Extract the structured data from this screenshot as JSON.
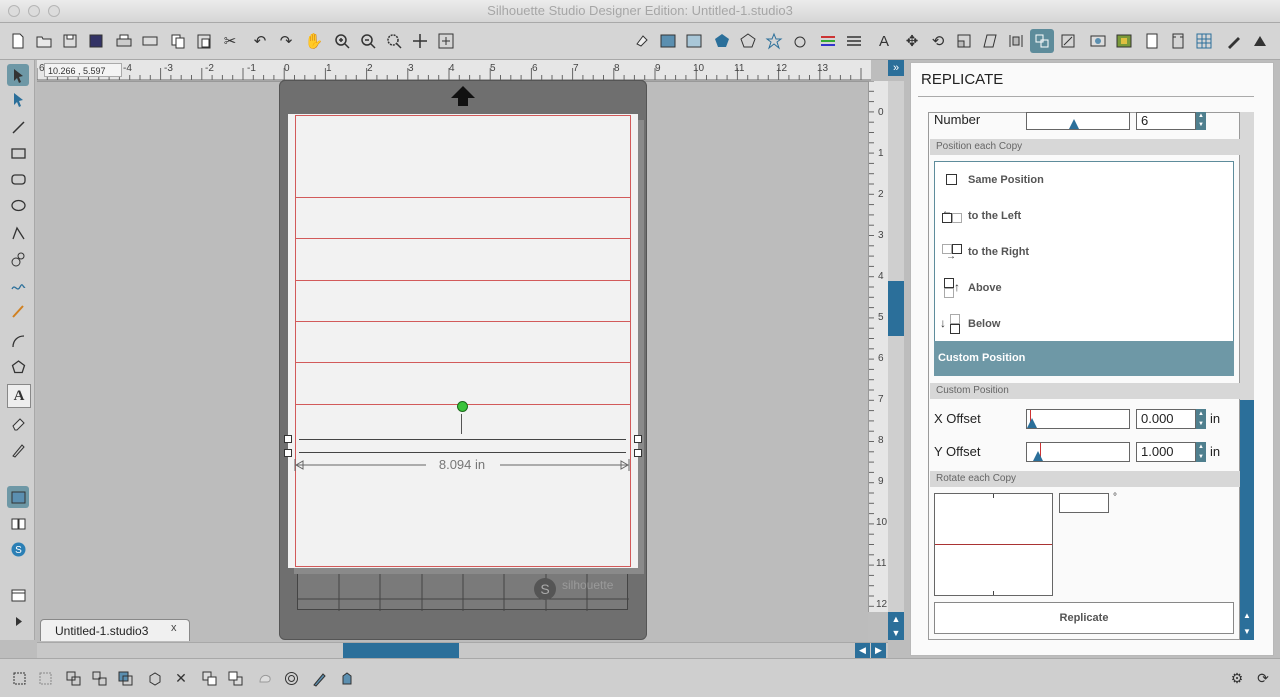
{
  "window": {
    "title": "Silhouette Studio Designer Edition: Untitled-1.studio3"
  },
  "coordinates": "10.266 , 5.597",
  "rulers": {
    "top": [
      "6",
      "-4",
      "-3",
      "-2",
      "-1",
      "0",
      "1",
      "2",
      "3",
      "4",
      "5",
      "6",
      "7",
      "8",
      "9",
      "10",
      "11",
      "12",
      "13"
    ],
    "side": [
      "0",
      "1",
      "2",
      "3",
      "4",
      "5",
      "6",
      "7",
      "8",
      "9",
      "10",
      "11",
      "12"
    ]
  },
  "document": {
    "tab_label": "Untitled-1.studio3",
    "tab_close": "x",
    "dimension_label": "8.094 in",
    "mat_brand": "silhouette"
  },
  "panel": {
    "title": "REPLICATE",
    "number_label": "Number",
    "number_value": "6",
    "position_section": "Position each Copy",
    "options": [
      "Same Position",
      "to the Left",
      "to the Right",
      "Above",
      "Below",
      "Custom Position"
    ],
    "custom_section": "Custom Position",
    "x_offset_label": "X Offset",
    "x_offset_value": "0.000",
    "y_offset_label": "Y Offset",
    "y_offset_value": "1.000",
    "unit": "in",
    "rotate_section": "Rotate each Copy",
    "rotate_value": "",
    "degree_symbol": "°",
    "replicate_button": "Replicate"
  },
  "colors": {
    "accent": "#5e8c9b",
    "cut_line": "#d25a5a"
  }
}
